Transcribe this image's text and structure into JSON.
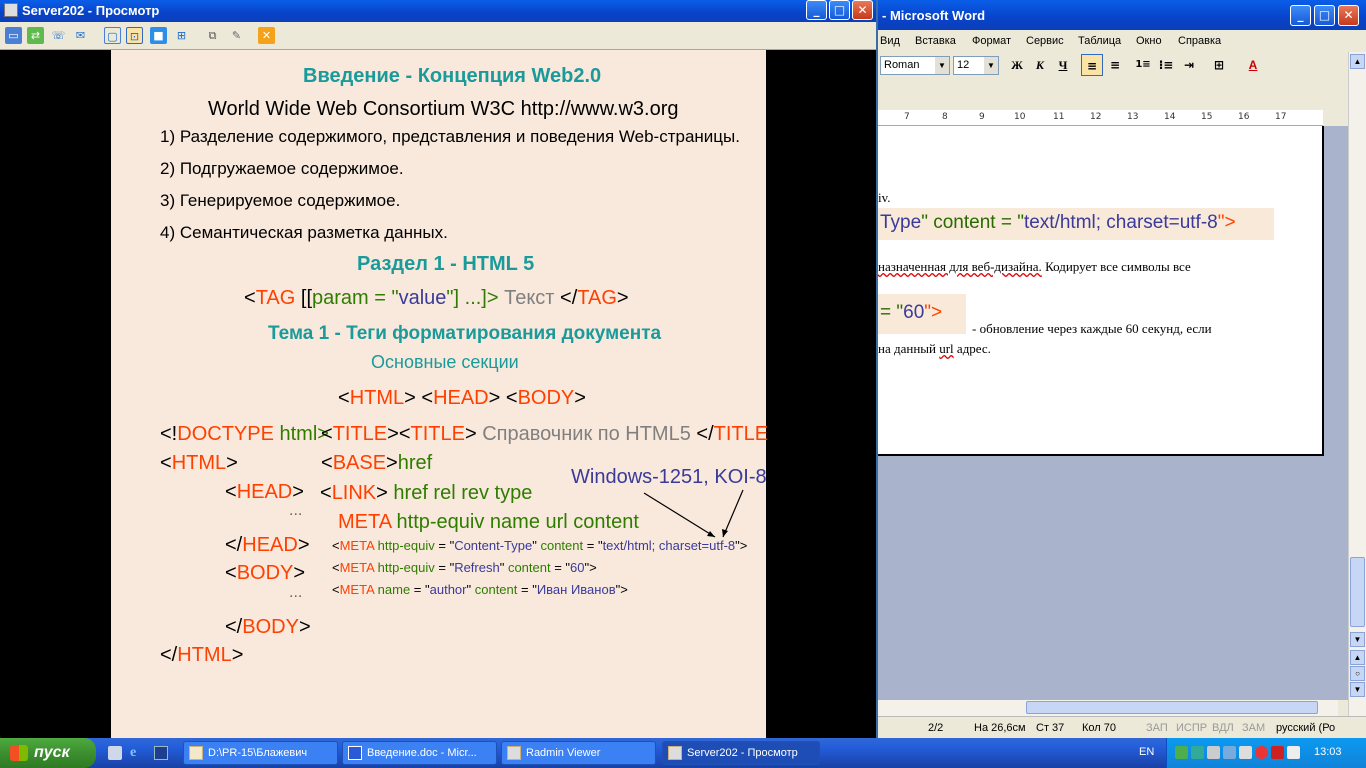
{
  "radmin": {
    "title": "Server202 - Просмотр",
    "controls": {
      "minimize": "_",
      "maximize": "□",
      "close": "✕"
    }
  },
  "slide": {
    "heading1": "Введение - Концепция Web2.0",
    "consortium": "World Wide Web Consortium  W3C  http://www.w3.org",
    "items": [
      "1) Разделение содержимого, представления и поведения Web-страницы.",
      "2) Подгружаемое содержимое.",
      "3) Генерируемое содержимое.",
      "4) Семантическая разметка данных."
    ],
    "heading2": "Раздел 1 - HTML 5",
    "tag_syntax": {
      "lt": "<",
      "tag": "TAG",
      "open": " [[",
      "param": "param",
      "eq": " = \"",
      "value": "value",
      "close_q": "\"] ...]>",
      "text": " Текст ",
      "lt2": "</",
      "tag2": "TAG",
      "gt": ">"
    },
    "heading3": "Тема 1 - Теги форматирования документа",
    "subheading": "Основные секции",
    "sections": {
      "html": "HTML",
      "head": "HEAD",
      "body": "BODY"
    },
    "doctype": {
      "prefix": "<!",
      "name": "DOCTYPE",
      "val": " html>"
    },
    "title_line": {
      "tag": "TITLE",
      "text": " Справочник по HTML5 "
    },
    "html_open": "HTML",
    "base_tag": "BASE",
    "base_attr": "href",
    "link_tag": "LINK",
    "link_attrs": "href  rel  rev  type",
    "encoding_note": "Windows-1251, KOI-8",
    "ellipsis": "...",
    "meta_tag": "META",
    "meta_attrs": "http-equiv  name  url  content",
    "head_open": "HEAD",
    "head_close": "HEAD",
    "body_open": "BODY",
    "body_close": "BODY",
    "html_close": "HTML",
    "meta_examples": [
      {
        "attr": "http-equiv",
        "attrval": "Content-Type",
        "content": "text/html; charset=utf-8"
      },
      {
        "attr": "http-equiv",
        "attrval": "Refresh",
        "content": "60"
      },
      {
        "attr": "name",
        "attrval": "author",
        "content": "Иван Иванов"
      }
    ]
  },
  "word": {
    "title": "- Microsoft Word",
    "menu": [
      "Вид",
      "Вставка",
      "Формат",
      "Сервис",
      "Таблица",
      "Окно",
      "Справка"
    ],
    "font_name": "Roman",
    "font_size": "12",
    "bold": "Ж",
    "italic": "К",
    "underline": "Ч",
    "ruler_marks": [
      "7",
      "8",
      "9",
      "10",
      "11",
      "12",
      "13",
      "14",
      "15",
      "16",
      "17"
    ],
    "doc": {
      "line1": "iv.",
      "code1": {
        "a": "Type",
        "b": "\" content = \"",
        "c": "text/html; charset=utf-8",
        "d": "\">"
      },
      "line2_a": "назначенная для веб-дизайна.",
      "line2_b": " Кодирует все символы все",
      "code2": {
        "a": " = \"",
        "b": "60",
        "c": "\">"
      },
      "line3": " - обновление через каждые 60 секунд, если",
      "line4_a": "на данный ",
      "line4_b": "url",
      "line4_c": " адрес."
    },
    "status": {
      "page": "2/2",
      "pos": "На 26,6см",
      "line": "Ст  37",
      "col": "Кол  70",
      "rec": "ЗАП",
      "trk": "ИСПР",
      "ext": "ВДЛ",
      "ovr": "ЗАМ",
      "lang": "русский (Ро"
    }
  },
  "taskbar": {
    "start": "пуск",
    "tasks": [
      {
        "label": "D:\\PR-15\\Блажевич"
      },
      {
        "label": "Введение.doc - Micr..."
      },
      {
        "label": "Radmin Viewer"
      },
      {
        "label": "Server202 - Просмотр"
      }
    ],
    "lang": "EN",
    "clock": "13:03"
  }
}
